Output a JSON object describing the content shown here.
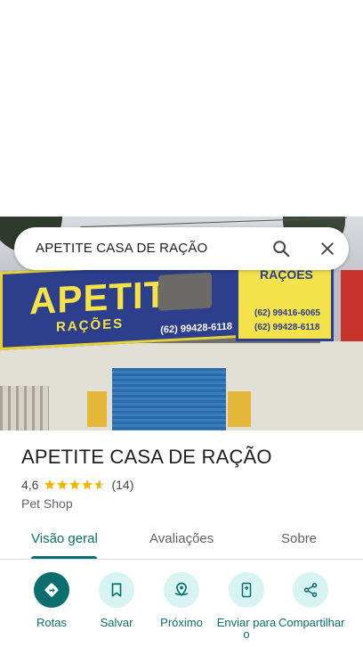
{
  "search": {
    "query": "APETITE CASA DE RAÇÃO"
  },
  "photo": {
    "sign_brand": "APETITE",
    "sign_sub": "RAÇÕES",
    "sign_phone": "(62) 99428-6118",
    "side_brand": "RAÇÕES",
    "side_phone_1": "(62) 99416-6065",
    "side_phone_2": "(62) 99428-6118"
  },
  "place": {
    "title": "APETITE CASA DE RAÇÃO",
    "rating": "4,6",
    "rating_stars": 4.6,
    "review_count": "(14)",
    "category": "Pet Shop"
  },
  "tabs": [
    {
      "label": "Visão geral",
      "active": true
    },
    {
      "label": "Avaliações",
      "active": false
    },
    {
      "label": "Sobre",
      "active": false
    }
  ],
  "actions": [
    {
      "label": "Rotas",
      "icon": "directions-icon"
    },
    {
      "label": "Salvar",
      "icon": "bookmark-icon"
    },
    {
      "label": "Próximo",
      "icon": "nearby-icon"
    },
    {
      "label": "Enviar para o",
      "icon": "send-to-phone-icon"
    },
    {
      "label": "Compartilhar",
      "icon": "share-icon"
    }
  ],
  "colors": {
    "accent": "#0b6e6e",
    "action_bg": "#d7f3f3",
    "star": "#f4b400"
  }
}
